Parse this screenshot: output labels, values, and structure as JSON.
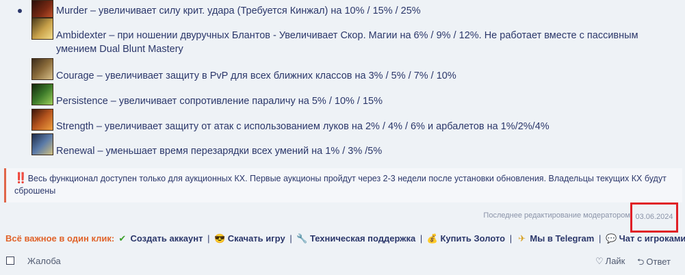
{
  "skills": [
    {
      "text": "Murder – увеличивает силу крит. удара (Требуется Кинжал) на 10% / 15% / 25%",
      "icon": "murder-skill-icon",
      "color": "#7a2a14"
    },
    {
      "text": "Ambidexter – при ношении двуручных Блантов - Увеличивает Скор. Магии на 6% / 9% / 12%. Не работает вместе с пассивным умением Dual Blunt Mastery",
      "icon": "ambidexter-skill-icon",
      "color": "#c9a24a"
    },
    {
      "text": "Courage – увеличивает защиту в PvP для всех ближних классов на 3% / 5% / 7% / 10%",
      "icon": "courage-skill-icon",
      "color": "#8a6b3a"
    },
    {
      "text": "Persistence – увеличивает сопротивление параличу на 5% / 10% / 15%",
      "icon": "persistence-skill-icon",
      "color": "#3d7a2a"
    },
    {
      "text": "Strength – увеличивает защиту от атак с использованием луков на 2% / 4% / 6% и арбалетов на 1%/2%/4%",
      "icon": "strength-skill-icon",
      "color": "#b5541e"
    },
    {
      "text": "Renewal – уменьшает время перезарядки всех умений на 1% / 3% /5%",
      "icon": "renewal-skill-icon",
      "color": "#5a7aa8"
    }
  ],
  "notice": {
    "icon": "‼️",
    "text": "Весь функционал доступен только для аукционных КХ. Первые аукционы пройдут через 2-3 недели после установки обновления. Владельцы текущих КХ будут сброшены"
  },
  "edited": {
    "label": "Последнее редактирование модератором:",
    "date": "03.06.2024"
  },
  "quick_links": {
    "lead": "Всё важное в один клик:",
    "items": [
      {
        "icon": "✔",
        "label": "Создать аккаунт"
      },
      {
        "icon": "😎",
        "label": "Скачать игру"
      },
      {
        "icon": "🔧",
        "label": "Техническая поддержка"
      },
      {
        "icon": "💰",
        "label": "Купить Золото"
      },
      {
        "icon": "✈",
        "label": "Мы в Telegram"
      },
      {
        "icon": "💬",
        "label": "Чат с игроками"
      }
    ]
  },
  "footer": {
    "report": "Жалоба",
    "like": "Лайк",
    "reply": "Ответ"
  }
}
